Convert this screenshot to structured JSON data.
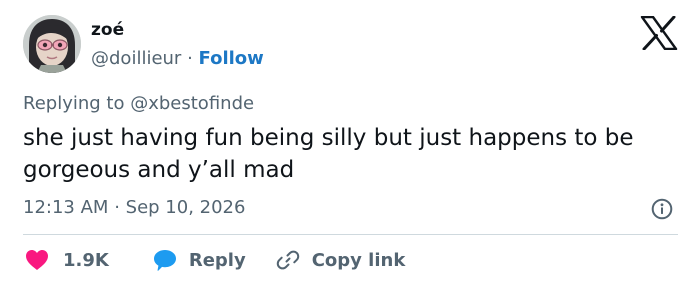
{
  "user": {
    "display_name": "zoé",
    "handle": "@doillieur",
    "separator": "·",
    "follow_label": "Follow"
  },
  "reply_context": {
    "prefix": "Replying to",
    "handle": "@xbestofinde"
  },
  "tweet": {
    "text": "she just having fun being silly but just happens to be gorgeous and y’all mad",
    "time": "12:13 AM",
    "separator": "·",
    "date": "Sep 10, 2026"
  },
  "actions": {
    "like_count": "1.9K",
    "reply_label": "Reply",
    "copy_link_label": "Copy link"
  },
  "icons": {
    "brand": "x-logo-icon",
    "info": "info-icon",
    "like": "heart-icon",
    "reply": "speech-bubble-icon",
    "copy": "link-icon"
  },
  "colors": {
    "like": "#f91880",
    "reply": "#1d9bf0",
    "follow": "#1d78c5",
    "muted": "#536471",
    "text": "#0f1419"
  }
}
